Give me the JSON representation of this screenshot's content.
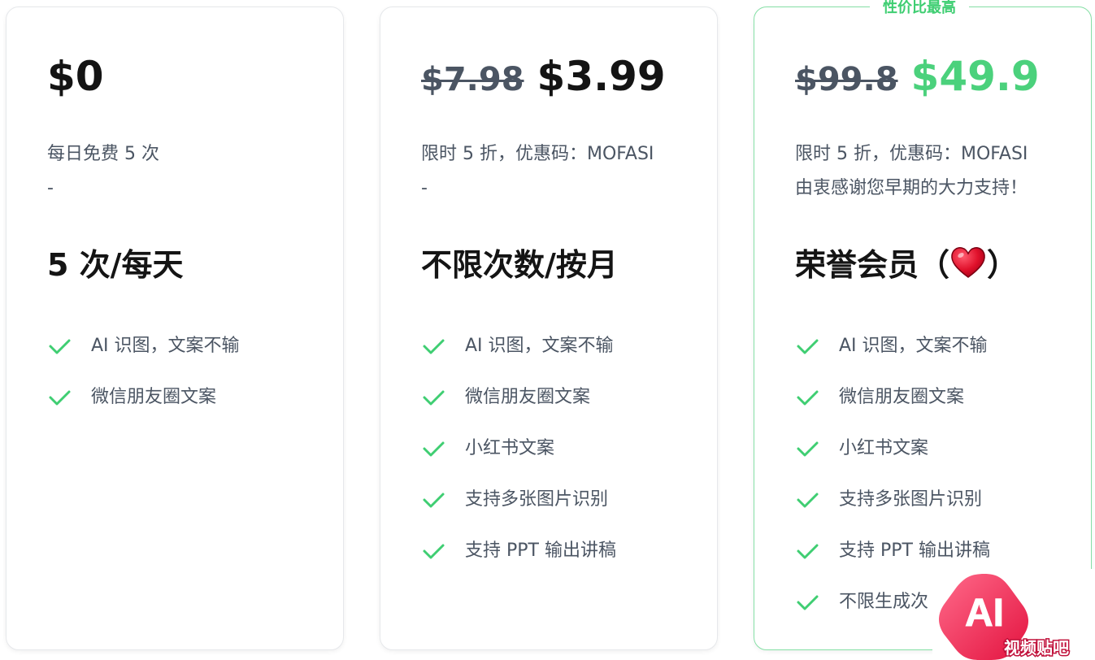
{
  "colors": {
    "accent_green": "#4bd17c",
    "check_green": "#3fce72",
    "text_dark": "#141414",
    "text_gray": "#4b5563",
    "heart_red": "#e0112b"
  },
  "plans": [
    {
      "price_old": "",
      "price": "$0",
      "desc_line1": "每日免费 5 次",
      "desc_line2": "-",
      "title": "5 次/每天",
      "features": [
        "AI 识图，文案不输",
        "微信朋友圈文案"
      ]
    },
    {
      "price_old": "$7.98",
      "price": "$3.99",
      "desc_line1": "限时 5 折，优惠码：MOFASI",
      "desc_line2": "-",
      "title": "不限次数/按月",
      "features": [
        "AI 识图，文案不输",
        "微信朋友圈文案",
        "小红书文案",
        "支持多张图片识别",
        "支持 PPT 输出讲稿"
      ]
    },
    {
      "badge": "性价比最高",
      "price_old": "$99.8",
      "price": "$49.9",
      "desc_line1": "限时 5 折，优惠码：MOFASI",
      "desc_line2": "由衷感谢您早期的大力支持！",
      "title_prefix": "荣誉会员（",
      "title_suffix": "）",
      "title_icon": "red-heart-icon",
      "features": [
        "AI 识图，文案不输",
        "微信朋友圈文案",
        "小红书文案",
        "支持多张图片识别",
        "支持 PPT 输出讲稿",
        "不限生成次"
      ]
    }
  ],
  "watermark": {
    "logo_text": "AI",
    "caption": "视频贴吧"
  }
}
